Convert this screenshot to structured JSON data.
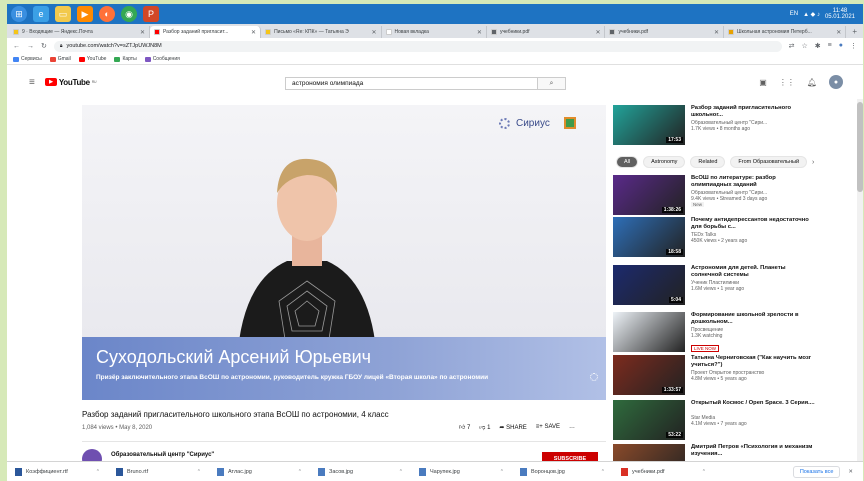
{
  "os": {
    "lang": "EN",
    "time": "11:48",
    "date": "05.01.2021"
  },
  "tabs": [
    {
      "label": "9 · Входящие — Яндекс.Почта",
      "color": "#f5c518",
      "active": false
    },
    {
      "label": "Разбор заданий пригласит...",
      "color": "#ff0000",
      "active": true
    },
    {
      "label": "Письмо «Re: КПК» — Татьяна Э",
      "color": "#f5c518",
      "active": false
    },
    {
      "label": "Новая вкладка",
      "color": "#ffffff",
      "active": false
    },
    {
      "label": "учебники.pdf",
      "color": "#5f6368",
      "active": false
    },
    {
      "label": "учебники.pdf",
      "color": "#5f6368",
      "active": false
    },
    {
      "label": "Школьная астрономия Петерб...",
      "color": "#e8a200",
      "active": false
    }
  ],
  "address": {
    "url": "youtube.com/watch?v=sZTJpUWJN8M"
  },
  "bookmarks": [
    {
      "label": "Сервисы",
      "color": "#4285f4"
    },
    {
      "label": "Gmail",
      "color": "#ea4335"
    },
    {
      "label": "YouTube",
      "color": "#ff0000"
    },
    {
      "label": "Карты",
      "color": "#34a853"
    },
    {
      "label": "Сообщения",
      "color": "#7e57c2"
    }
  ],
  "youtube": {
    "logo": "YouTube",
    "logo_sup": "RU",
    "search_value": "астрономия олимпиада"
  },
  "video": {
    "overlay_name": "Суходольский Арсений Юрьевич",
    "overlay_sub": "Призёр заключительного этапа ВсОШ по астрономии, руководитель кружка ГБОУ лицей «Вторая школа» по астрономии",
    "brand": "Сириус",
    "title": "Разбор заданий пригласительного школьного этапа ВсОШ по астрономии, 4 класс",
    "meta": "1,084 views • May 8, 2020",
    "likes": "7",
    "dislikes": "1",
    "share": "SHARE",
    "save": "SAVE",
    "more": "…",
    "channel": "Образовательный центр \"Сириус\"",
    "subscribe": "SUBSCRIBE"
  },
  "chips": [
    "All",
    "Astronomy",
    "Related",
    "From Образовательный"
  ],
  "recommendations": [
    {
      "title": "Разбор заданий пригласительного школьног...",
      "channel": "Образовательный центр \"Сири...",
      "views": "1.7K views • 8 months ago",
      "duration": "17:53",
      "badge": "",
      "thumb": "#22a39a"
    },
    {
      "title": "ВсОШ по литературе: разбор олимпиадных заданий",
      "channel": "Образовательный центр \"Сири...",
      "views": "9.4K views • Streamed 3 days ago",
      "duration": "1:38:26",
      "badge": "New",
      "thumb": "#5a2a8a"
    },
    {
      "title": "Почему антидепрессантов недостаточно для борьбы с...",
      "channel": "TEDx Talks",
      "views": "450K views • 2 years ago",
      "duration": "18:58",
      "badge": "",
      "thumb": "#2e6fb8"
    },
    {
      "title": "Астрономия для детей. Планеты солнечной системы",
      "channel": "Ученик Пластилинки",
      "views": "1.6M views • 1 year ago",
      "duration": "5:04",
      "badge": "",
      "thumb": "#1c2a6e"
    },
    {
      "title": "Формирование школьной зрелости в дошкольном...",
      "channel": "Просвещение",
      "views": "1.3K watching",
      "duration": "",
      "badge": "LIVE NOW",
      "thumb": "#eef3f8"
    },
    {
      "title": "Татьяна Черниговская (\"Как научить мозг учиться?\")",
      "channel": "Проект Открытое пространство",
      "views": "4.8M views • 5 years ago",
      "duration": "1:33:57",
      "badge": "",
      "thumb": "#7d2b1e"
    },
    {
      "title": "Открытый Космос / Open Space. 3 Серия....",
      "channel": "Star Media",
      "views": "4.1M views • 7 years ago",
      "duration": "53:22",
      "badge": "",
      "thumb": "#2f6b3d"
    },
    {
      "title": "Дмитрий Петров «Психология и механизм изучения...",
      "channel": "",
      "views": "",
      "duration": "",
      "badge": "",
      "thumb": "#8a4a2a"
    }
  ],
  "downloads": [
    {
      "name": "Коэффициент.rtf",
      "color": "#2b579a"
    },
    {
      "name": "Bruno.rtf",
      "color": "#2b579a"
    },
    {
      "name": "Атлас.jpg",
      "color": "#4a7bbf"
    },
    {
      "name": "Засов.jpg",
      "color": "#4a7bbf"
    },
    {
      "name": "Чарупек.jpg",
      "color": "#4a7bbf"
    },
    {
      "name": "Воронцов.jpg",
      "color": "#4a7bbf"
    },
    {
      "name": "учебники.pdf",
      "color": "#d93025"
    }
  ],
  "download_bar": {
    "show_all": "Показать все",
    "close": "✕"
  }
}
